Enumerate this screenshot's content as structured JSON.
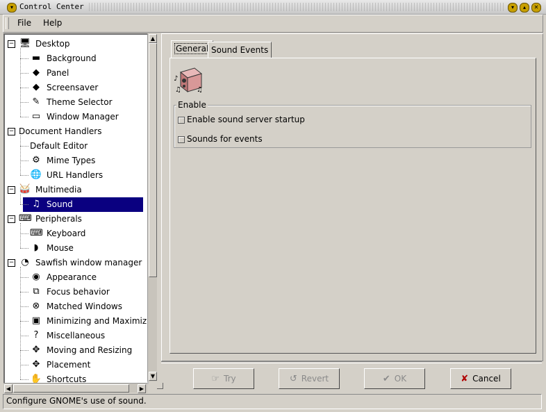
{
  "window": {
    "title": "Control Center"
  },
  "menubar": {
    "file": "File",
    "help": "Help"
  },
  "tree": {
    "items": [
      {
        "label": "Desktop",
        "level": 0,
        "icon": "desktop-icon",
        "glyph": "🖥",
        "expander": "−"
      },
      {
        "label": "Background",
        "level": 1,
        "icon": "background-icon",
        "glyph": "▬"
      },
      {
        "label": "Panel",
        "level": 1,
        "icon": "panel-icon",
        "glyph": "◆"
      },
      {
        "label": "Screensaver",
        "level": 1,
        "icon": "screensaver-icon",
        "glyph": "◆"
      },
      {
        "label": "Theme Selector",
        "level": 1,
        "icon": "theme-selector-icon",
        "glyph": "✎"
      },
      {
        "label": "Window Manager",
        "level": 1,
        "icon": "window-manager-icon",
        "glyph": "▭"
      },
      {
        "label": "Document Handlers",
        "level": 0,
        "icon": "",
        "glyph": "",
        "expander": "−"
      },
      {
        "label": "Default Editor",
        "level": 1,
        "icon": "",
        "glyph": ""
      },
      {
        "label": "Mime Types",
        "level": 1,
        "icon": "mime-types-icon",
        "glyph": "⚙"
      },
      {
        "label": "URL Handlers",
        "level": 1,
        "icon": "url-handlers-icon",
        "glyph": "🌐"
      },
      {
        "label": "Multimedia",
        "level": 0,
        "icon": "multimedia-icon",
        "glyph": "🥁",
        "expander": "−"
      },
      {
        "label": "Sound",
        "level": 1,
        "icon": "sound-icon",
        "glyph": "♫",
        "selected": true
      },
      {
        "label": "Peripherals",
        "level": 0,
        "icon": "peripherals-icon",
        "glyph": "⌨",
        "expander": "−"
      },
      {
        "label": "Keyboard",
        "level": 1,
        "icon": "keyboard-icon",
        "glyph": "⌨"
      },
      {
        "label": "Mouse",
        "level": 1,
        "icon": "mouse-icon",
        "glyph": "◗"
      },
      {
        "label": "Sawfish window manager",
        "level": 0,
        "icon": "sawfish-icon",
        "glyph": "◔",
        "expander": "−"
      },
      {
        "label": "Appearance",
        "level": 1,
        "icon": "appearance-icon",
        "glyph": "◉"
      },
      {
        "label": "Focus behavior",
        "level": 1,
        "icon": "focus-behavior-icon",
        "glyph": "⧉"
      },
      {
        "label": "Matched Windows",
        "level": 1,
        "icon": "matched-windows-icon",
        "glyph": "⊗"
      },
      {
        "label": "Minimizing and Maximizing",
        "level": 1,
        "icon": "minimizing-icon",
        "glyph": "▣"
      },
      {
        "label": "Miscellaneous",
        "level": 1,
        "icon": "miscellaneous-icon",
        "glyph": "?"
      },
      {
        "label": "Moving and Resizing",
        "level": 1,
        "icon": "moving-resizing-icon",
        "glyph": "✥"
      },
      {
        "label": "Placement",
        "level": 1,
        "icon": "placement-icon",
        "glyph": "✥"
      },
      {
        "label": "Shortcuts",
        "level": 1,
        "icon": "shortcuts-icon",
        "glyph": "✋"
      }
    ]
  },
  "tabs": {
    "general": "General",
    "sound_events": "Sound Events"
  },
  "enable_group": {
    "label": "Enable",
    "server_startup": "Enable sound server startup",
    "sounds_for_events": "Sounds for events"
  },
  "buttons": {
    "try": "Try",
    "revert": "Revert",
    "ok": "OK",
    "cancel": "Cancel"
  },
  "status": {
    "text": "Configure GNOME's use of sound."
  }
}
